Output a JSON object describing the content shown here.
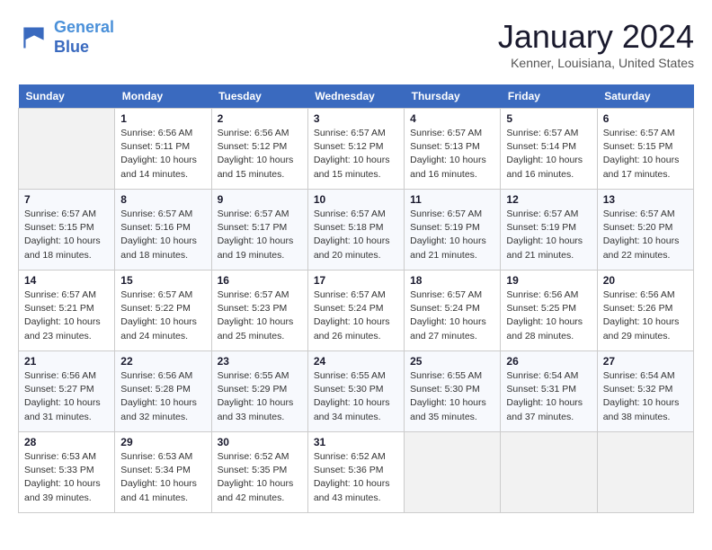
{
  "logo": {
    "line1": "General",
    "line2": "Blue"
  },
  "title": "January 2024",
  "location": "Kenner, Louisiana, United States",
  "days_of_week": [
    "Sunday",
    "Monday",
    "Tuesday",
    "Wednesday",
    "Thursday",
    "Friday",
    "Saturday"
  ],
  "weeks": [
    [
      {
        "day": "",
        "empty": true
      },
      {
        "day": "1",
        "sunrise": "6:56 AM",
        "sunset": "5:11 PM",
        "daylight": "10 hours and 14 minutes."
      },
      {
        "day": "2",
        "sunrise": "6:56 AM",
        "sunset": "5:12 PM",
        "daylight": "10 hours and 15 minutes."
      },
      {
        "day": "3",
        "sunrise": "6:57 AM",
        "sunset": "5:12 PM",
        "daylight": "10 hours and 15 minutes."
      },
      {
        "day": "4",
        "sunrise": "6:57 AM",
        "sunset": "5:13 PM",
        "daylight": "10 hours and 16 minutes."
      },
      {
        "day": "5",
        "sunrise": "6:57 AM",
        "sunset": "5:14 PM",
        "daylight": "10 hours and 16 minutes."
      },
      {
        "day": "6",
        "sunrise": "6:57 AM",
        "sunset": "5:15 PM",
        "daylight": "10 hours and 17 minutes."
      }
    ],
    [
      {
        "day": "7",
        "sunrise": "6:57 AM",
        "sunset": "5:15 PM",
        "daylight": "10 hours and 18 minutes."
      },
      {
        "day": "8",
        "sunrise": "6:57 AM",
        "sunset": "5:16 PM",
        "daylight": "10 hours and 18 minutes."
      },
      {
        "day": "9",
        "sunrise": "6:57 AM",
        "sunset": "5:17 PM",
        "daylight": "10 hours and 19 minutes."
      },
      {
        "day": "10",
        "sunrise": "6:57 AM",
        "sunset": "5:18 PM",
        "daylight": "10 hours and 20 minutes."
      },
      {
        "day": "11",
        "sunrise": "6:57 AM",
        "sunset": "5:19 PM",
        "daylight": "10 hours and 21 minutes."
      },
      {
        "day": "12",
        "sunrise": "6:57 AM",
        "sunset": "5:19 PM",
        "daylight": "10 hours and 21 minutes."
      },
      {
        "day": "13",
        "sunrise": "6:57 AM",
        "sunset": "5:20 PM",
        "daylight": "10 hours and 22 minutes."
      }
    ],
    [
      {
        "day": "14",
        "sunrise": "6:57 AM",
        "sunset": "5:21 PM",
        "daylight": "10 hours and 23 minutes."
      },
      {
        "day": "15",
        "sunrise": "6:57 AM",
        "sunset": "5:22 PM",
        "daylight": "10 hours and 24 minutes."
      },
      {
        "day": "16",
        "sunrise": "6:57 AM",
        "sunset": "5:23 PM",
        "daylight": "10 hours and 25 minutes."
      },
      {
        "day": "17",
        "sunrise": "6:57 AM",
        "sunset": "5:24 PM",
        "daylight": "10 hours and 26 minutes."
      },
      {
        "day": "18",
        "sunrise": "6:57 AM",
        "sunset": "5:24 PM",
        "daylight": "10 hours and 27 minutes."
      },
      {
        "day": "19",
        "sunrise": "6:56 AM",
        "sunset": "5:25 PM",
        "daylight": "10 hours and 28 minutes."
      },
      {
        "day": "20",
        "sunrise": "6:56 AM",
        "sunset": "5:26 PM",
        "daylight": "10 hours and 29 minutes."
      }
    ],
    [
      {
        "day": "21",
        "sunrise": "6:56 AM",
        "sunset": "5:27 PM",
        "daylight": "10 hours and 31 minutes."
      },
      {
        "day": "22",
        "sunrise": "6:56 AM",
        "sunset": "5:28 PM",
        "daylight": "10 hours and 32 minutes."
      },
      {
        "day": "23",
        "sunrise": "6:55 AM",
        "sunset": "5:29 PM",
        "daylight": "10 hours and 33 minutes."
      },
      {
        "day": "24",
        "sunrise": "6:55 AM",
        "sunset": "5:30 PM",
        "daylight": "10 hours and 34 minutes."
      },
      {
        "day": "25",
        "sunrise": "6:55 AM",
        "sunset": "5:30 PM",
        "daylight": "10 hours and 35 minutes."
      },
      {
        "day": "26",
        "sunrise": "6:54 AM",
        "sunset": "5:31 PM",
        "daylight": "10 hours and 37 minutes."
      },
      {
        "day": "27",
        "sunrise": "6:54 AM",
        "sunset": "5:32 PM",
        "daylight": "10 hours and 38 minutes."
      }
    ],
    [
      {
        "day": "28",
        "sunrise": "6:53 AM",
        "sunset": "5:33 PM",
        "daylight": "10 hours and 39 minutes."
      },
      {
        "day": "29",
        "sunrise": "6:53 AM",
        "sunset": "5:34 PM",
        "daylight": "10 hours and 41 minutes."
      },
      {
        "day": "30",
        "sunrise": "6:52 AM",
        "sunset": "5:35 PM",
        "daylight": "10 hours and 42 minutes."
      },
      {
        "day": "31",
        "sunrise": "6:52 AM",
        "sunset": "5:36 PM",
        "daylight": "10 hours and 43 minutes."
      },
      {
        "day": "",
        "empty": true
      },
      {
        "day": "",
        "empty": true
      },
      {
        "day": "",
        "empty": true
      }
    ]
  ],
  "labels": {
    "sunrise": "Sunrise:",
    "sunset": "Sunset:",
    "daylight": "Daylight:"
  }
}
